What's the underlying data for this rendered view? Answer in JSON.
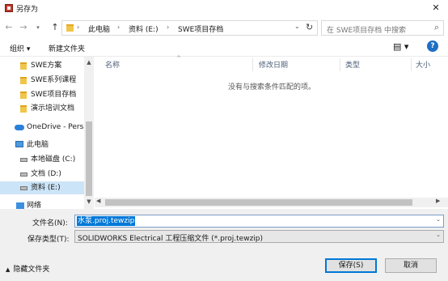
{
  "window": {
    "title": "另存为"
  },
  "nav": {
    "address_crumbs": [
      "此电脑",
      "资料 (E:)",
      "SWE项目存档"
    ],
    "search_placeholder": "在 SWE项目存档 中搜索"
  },
  "toolbar": {
    "organize": "组织 ▾",
    "new_folder": "新建文件夹"
  },
  "sidebar": {
    "items": [
      {
        "label": "SWE方案"
      },
      {
        "label": "SWE系列课程"
      },
      {
        "label": "SWE项目存档"
      },
      {
        "label": "演示培训文档"
      },
      {
        "label": "OneDrive - Perso"
      },
      {
        "label": "此电脑"
      },
      {
        "label": "本地磁盘 (C:)"
      },
      {
        "label": "文档 (D:)"
      },
      {
        "label": "资料 (E:)"
      },
      {
        "label": "网络"
      }
    ]
  },
  "list": {
    "columns": [
      "名称",
      "修改日期",
      "类型",
      "大小"
    ],
    "empty_message": "没有与搜索条件匹配的项。"
  },
  "form": {
    "filename_label": "文件名(N):",
    "filename_value": "水泵.proj.tewzip",
    "type_label": "保存类型(T):",
    "type_value": "SOLIDWORKS Electrical 工程压缩文件 (*.proj.tewzip)"
  },
  "footer": {
    "hide_folders": "隐藏文件夹",
    "save": "保存(S)",
    "cancel": "取消"
  },
  "colors": {
    "accent": "#0078d7",
    "selected_bg": "#cce4f7"
  }
}
